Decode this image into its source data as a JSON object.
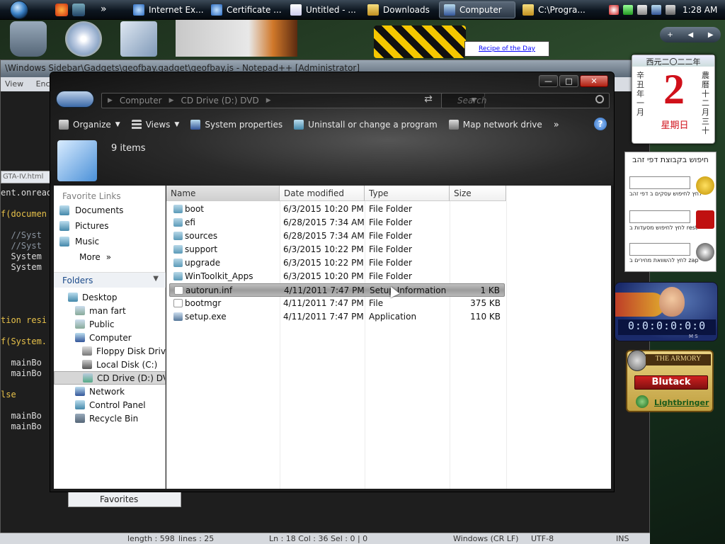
{
  "taskbar": {
    "buttons": [
      {
        "label": "Internet Ex..."
      },
      {
        "label": "Certificate ..."
      },
      {
        "label": "Untitled - ..."
      },
      {
        "label": "Downloads"
      },
      {
        "label": "Computer"
      },
      {
        "label": "C:\\Progra..."
      }
    ],
    "more": "»",
    "clock": "1:28 AM"
  },
  "desktop": {
    "recipe_link": "Recipe of the Day"
  },
  "notepad": {
    "title": "\\Windows Sidebar\\Gadgets\\geofbay.gadget\\geofbay.js - Notepad++ [Administrator]",
    "menu": [
      "View",
      "Enc"
    ],
    "tab": "GTA-IV.html",
    "code_lines": [
      {
        "text": "ent.onread",
        "cls": ""
      },
      {
        "text": "",
        "cls": ""
      },
      {
        "text": "f(documen",
        "cls": "kw"
      },
      {
        "text": "",
        "cls": ""
      },
      {
        "text": "  //Syst",
        "cls": "cm"
      },
      {
        "text": "  //Syst",
        "cls": "cm"
      },
      {
        "text": "  System",
        "cls": ""
      },
      {
        "text": "  System",
        "cls": ""
      },
      {
        "text": "",
        "cls": ""
      },
      {
        "text": "",
        "cls": ""
      },
      {
        "text": "",
        "cls": ""
      },
      {
        "text": "",
        "cls": ""
      },
      {
        "text": "tion resi",
        "cls": "kw"
      },
      {
        "text": "",
        "cls": ""
      },
      {
        "text": "f(System.",
        "cls": "kw"
      },
      {
        "text": "",
        "cls": ""
      },
      {
        "text": "  mainBo",
        "cls": ""
      },
      {
        "text": "  mainBo",
        "cls": ""
      },
      {
        "text": "",
        "cls": ""
      },
      {
        "text": "lse",
        "cls": "kw"
      },
      {
        "text": "",
        "cls": ""
      },
      {
        "text": "  mainBo",
        "cls": ""
      },
      {
        "text": "  mainBo",
        "cls": ""
      }
    ],
    "favorites": "Favorites",
    "status": {
      "length": "length : 598",
      "lines": "lines : 25",
      "pos": "Ln : 18    Col : 36    Sel : 0 | 0",
      "eol": "Windows (CR LF)",
      "enc": "UTF-8",
      "ins": "INS"
    }
  },
  "explorer": {
    "address": {
      "parts": [
        "Computer",
        "CD Drive (D:) DVD"
      ]
    },
    "search_placeholder": "Search",
    "toolbar": [
      {
        "label": "Organize",
        "dropdown": true
      },
      {
        "label": "Views",
        "dropdown": true
      },
      {
        "label": "System properties"
      },
      {
        "label": "Uninstall or change a program"
      },
      {
        "label": "Map network drive"
      }
    ],
    "toolbar_more": "»",
    "items_count": "9 items",
    "favorite_links_title": "Favorite Links",
    "favorites": [
      "Documents",
      "Pictures",
      "Music"
    ],
    "favorites_more": "More",
    "folders_title": "Folders",
    "tree": [
      {
        "label": "Desktop",
        "level": 0
      },
      {
        "label": "man fart",
        "level": 1
      },
      {
        "label": "Public",
        "level": 1
      },
      {
        "label": "Computer",
        "level": 1
      },
      {
        "label": "Floppy Disk Drive",
        "level": 2
      },
      {
        "label": "Local Disk (C:)",
        "level": 2
      },
      {
        "label": "CD Drive (D:) DVD",
        "level": 2,
        "selected": true
      },
      {
        "label": "Network",
        "level": 1
      },
      {
        "label": "Control Panel",
        "level": 1
      },
      {
        "label": "Recycle Bin",
        "level": 1
      }
    ],
    "columns": [
      "Name",
      "Date modified",
      "Type",
      "Size"
    ],
    "files": [
      {
        "name": "boot",
        "date": "6/3/2015 10:20 PM",
        "type": "File Folder",
        "size": "",
        "icon": "folder"
      },
      {
        "name": "efi",
        "date": "6/28/2015 7:34 AM",
        "type": "File Folder",
        "size": "",
        "icon": "folder"
      },
      {
        "name": "sources",
        "date": "6/28/2015 7:34 AM",
        "type": "File Folder",
        "size": "",
        "icon": "folder"
      },
      {
        "name": "support",
        "date": "6/3/2015 10:22 PM",
        "type": "File Folder",
        "size": "",
        "icon": "folder"
      },
      {
        "name": "upgrade",
        "date": "6/3/2015 10:22 PM",
        "type": "File Folder",
        "size": "",
        "icon": "folder"
      },
      {
        "name": "WinToolkit_Apps",
        "date": "6/3/2015 10:20 PM",
        "type": "File Folder",
        "size": "",
        "icon": "folder"
      },
      {
        "name": "autorun.inf",
        "date": "4/11/2011 7:47 PM",
        "type": "Setup Information",
        "size": "1 KB",
        "icon": "file",
        "selected": true
      },
      {
        "name": "bootmgr",
        "date": "4/11/2011 7:47 PM",
        "type": "File",
        "size": "375 KB",
        "icon": "file"
      },
      {
        "name": "setup.exe",
        "date": "4/11/2011 7:47 PM",
        "type": "Application",
        "size": "110 KB",
        "icon": "app"
      }
    ]
  },
  "gadgets": {
    "calendar": {
      "top": "西元二〇二二年",
      "day": "2",
      "left": "辛丑年一月",
      "right": "農曆十二月三十",
      "weekday": "星期日"
    },
    "hebrew": {
      "title": "חיפוש בקבוצת דפי זהב",
      "caps": [
        "לחץ לחיפוש עסקים ב דפי זהב",
        "לחץ לחיפוש מסעדות ב rest",
        "לחץ להשוואת מחירים ב zap"
      ]
    },
    "clock": {
      "digits": "0:0:0:0:0:0",
      "labels": "M S"
    },
    "armory": {
      "title": "THE ARMORY",
      "name": "Blutack",
      "link": "Lightbringer"
    }
  }
}
